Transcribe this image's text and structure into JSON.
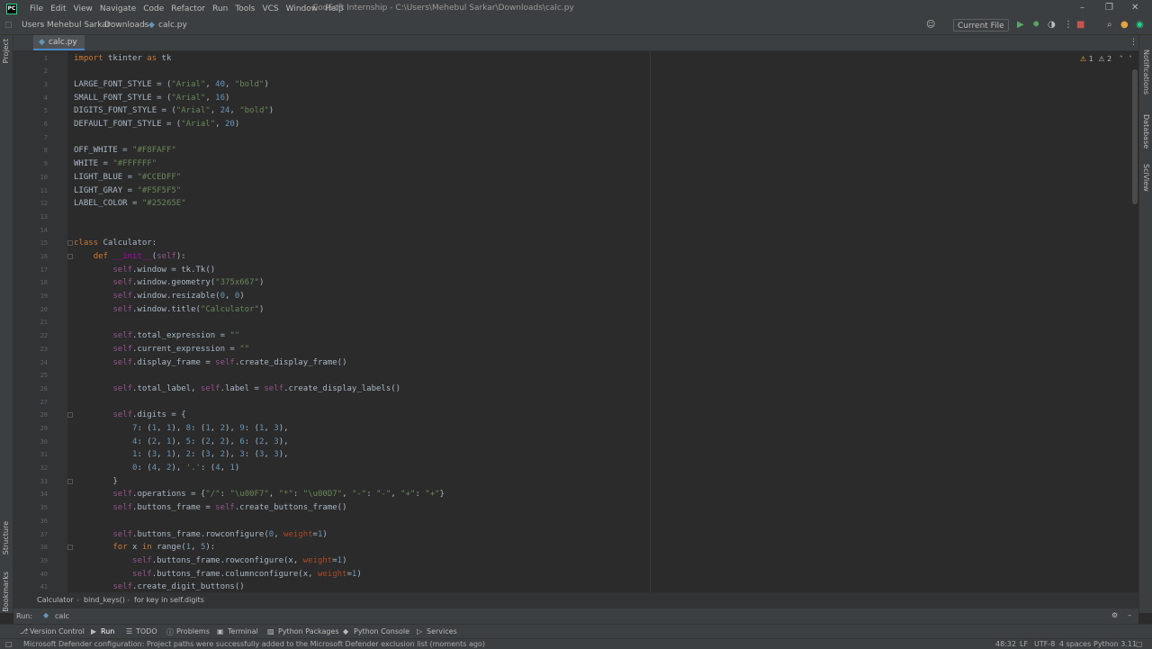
{
  "menu": [
    "File",
    "Edit",
    "View",
    "Navigate",
    "Code",
    "Refactor",
    "Run",
    "Tools",
    "VCS",
    "Window",
    "Help"
  ],
  "window_title": "CodSoft Internship - C:\\Users\\Mehebul Sarkar\\Downloads\\calc.py",
  "breadcrumb": [
    "Users",
    "Mehebul Sarkar",
    "Downloads",
    "calc.py"
  ],
  "run_config": "Current File",
  "tab": "calc.py",
  "left_tools": [
    "Project",
    "Structure",
    "Bookmarks"
  ],
  "right_tools": [
    "Notifications",
    "Database",
    "SciView"
  ],
  "inspections": {
    "warnings": "1",
    "weak": "2"
  },
  "code_lines": [
    {
      "n": "1",
      "t": "import tkinter as tk"
    },
    {
      "n": "2",
      "t": ""
    },
    {
      "n": "3",
      "t": "LARGE_FONT_STYLE = (\"Arial\", 40, \"bold\")"
    },
    {
      "n": "4",
      "t": "SMALL_FONT_STYLE = (\"Arial\", 16)"
    },
    {
      "n": "5",
      "t": "DIGITS_FONT_STYLE = (\"Arial\", 24, \"bold\")"
    },
    {
      "n": "6",
      "t": "DEFAULT_FONT_STYLE = (\"Arial\", 20)"
    },
    {
      "n": "7",
      "t": ""
    },
    {
      "n": "8",
      "t": "OFF_WHITE = \"#F8FAFF\""
    },
    {
      "n": "9",
      "t": "WHITE = \"#FFFFFF\""
    },
    {
      "n": "10",
      "t": "LIGHT_BLUE = \"#CCEDFF\""
    },
    {
      "n": "11",
      "t": "LIGHT_GRAY = \"#F5F5F5\""
    },
    {
      "n": "12",
      "t": "LABEL_COLOR = \"#25265E\""
    },
    {
      "n": "13",
      "t": ""
    },
    {
      "n": "14",
      "t": ""
    },
    {
      "n": "15",
      "t": "class Calculator:"
    },
    {
      "n": "16",
      "t": "    def __init__(self):"
    },
    {
      "n": "17",
      "t": "        self.window = tk.Tk()"
    },
    {
      "n": "18",
      "t": "        self.window.geometry(\"375x667\")"
    },
    {
      "n": "19",
      "t": "        self.window.resizable(0, 0)"
    },
    {
      "n": "20",
      "t": "        self.window.title(\"Calculator\")"
    },
    {
      "n": "21",
      "t": ""
    },
    {
      "n": "22",
      "t": "        self.total_expression = \"\""
    },
    {
      "n": "23",
      "t": "        self.current_expression = \"\""
    },
    {
      "n": "24",
      "t": "        self.display_frame = self.create_display_frame()"
    },
    {
      "n": "25",
      "t": ""
    },
    {
      "n": "26",
      "t": "        self.total_label, self.label = self.create_display_labels()"
    },
    {
      "n": "27",
      "t": ""
    },
    {
      "n": "28",
      "t": "        self.digits = {"
    },
    {
      "n": "29",
      "t": "            7: (1, 1), 8: (1, 2), 9: (1, 3),"
    },
    {
      "n": "30",
      "t": "            4: (2, 1), 5: (2, 2), 6: (2, 3),"
    },
    {
      "n": "31",
      "t": "            1: (3, 1), 2: (3, 2), 3: (3, 3),"
    },
    {
      "n": "32",
      "t": "            0: (4, 2), '.': (4, 1)"
    },
    {
      "n": "33",
      "t": "        }"
    },
    {
      "n": "34",
      "t": "        self.operations = {\"/\": \"\\u00F7\", \"*\": \"\\u00D7\", \"-\": \"-\", \"+\": \"+\"}"
    },
    {
      "n": "35",
      "t": "        self.buttons_frame = self.create_buttons_frame()"
    },
    {
      "n": "36",
      "t": ""
    },
    {
      "n": "37",
      "t": "        self.buttons_frame.rowconfigure(0, weight=1)"
    },
    {
      "n": "38",
      "t": "        for x in range(1, 5):"
    },
    {
      "n": "39",
      "t": "            self.buttons_frame.rowconfigure(x, weight=1)"
    },
    {
      "n": "40",
      "t": "            self.buttons_frame.columnconfigure(x, weight=1)"
    },
    {
      "n": "41",
      "t": "        self.create_digit_buttons()"
    }
  ],
  "editor_crumbs": [
    "Calculator",
    "bind_keys()",
    "for key in self.digits"
  ],
  "run": {
    "label": "Run:",
    "config": "calc"
  },
  "tool_tabs": [
    "Version Control",
    "Run",
    "TODO",
    "Problems",
    "Terminal",
    "Python Packages",
    "Python Console",
    "Services"
  ],
  "status": {
    "message": "Microsoft Defender configuration: Project paths were successfully added to the Microsoft Defender exclusion list (moments ago)",
    "position": "48:32",
    "line_sep": "LF",
    "encoding": "UTF-8",
    "indent": "4 spaces",
    "interpreter": "Python 3.11"
  },
  "colors": {
    "keyword": "#cc7832",
    "string": "#6a8759",
    "number": "#6897bb",
    "self": "#94558d",
    "accent": "#4a88c7"
  }
}
